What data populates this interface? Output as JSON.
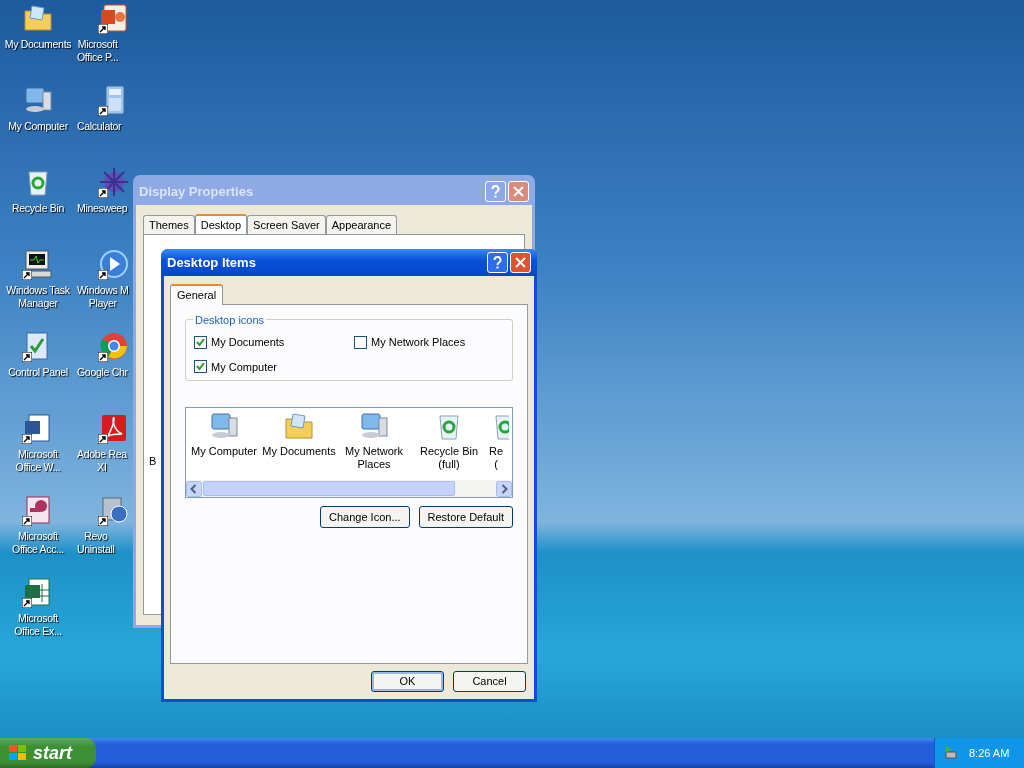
{
  "desktop_icons": [
    {
      "lines": [
        "My Documents"
      ],
      "shortcut": false
    },
    {
      "lines": [
        "Microsoft",
        "Office P..."
      ],
      "shortcut": true
    },
    {
      "lines": [
        "My Computer"
      ],
      "shortcut": false
    },
    {
      "lines": [
        "Calculator"
      ],
      "shortcut": true
    },
    {
      "lines": [
        "Recycle Bin"
      ],
      "shortcut": false
    },
    {
      "lines": [
        "Minesweep"
      ],
      "shortcut": true
    },
    {
      "lines": [
        "Windows Task",
        "Manager"
      ],
      "shortcut": true
    },
    {
      "lines": [
        "Windows M",
        "Player"
      ],
      "shortcut": true
    },
    {
      "lines": [
        "Control Panel"
      ],
      "shortcut": true
    },
    {
      "lines": [
        "Google Chr"
      ],
      "shortcut": true
    },
    {
      "lines": [
        "Microsoft",
        "Office W..."
      ],
      "shortcut": true
    },
    {
      "lines": [
        "Adobe Rea",
        "XI"
      ],
      "shortcut": true
    },
    {
      "lines": [
        "Microsoft",
        "Office Acc..."
      ],
      "shortcut": true
    },
    {
      "lines": [
        "Revo",
        "Uninstall"
      ],
      "shortcut": true
    },
    {
      "lines": [
        "Microsoft",
        "Office Ex..."
      ],
      "shortcut": true
    }
  ],
  "display_properties": {
    "title": "Display Properties",
    "tabs": [
      {
        "label": "Themes",
        "selected": false
      },
      {
        "label": "Desktop",
        "selected": true
      },
      {
        "label": "Screen Saver",
        "selected": false
      },
      {
        "label": "Appearance",
        "selected": false
      }
    ],
    "partial_label": "B"
  },
  "desktop_items": {
    "title": "Desktop Items",
    "tabs": [
      {
        "label": "General",
        "selected": true
      }
    ],
    "group_title": "Desktop icons",
    "checkboxes": [
      {
        "label": "My Documents",
        "checked": true
      },
      {
        "label": "My Network Places",
        "checked": false
      },
      {
        "label": "My Computer",
        "checked": true
      }
    ],
    "icons": [
      {
        "lines": [
          "My Computer"
        ]
      },
      {
        "lines": [
          "My Documents"
        ]
      },
      {
        "lines": [
          "My Network",
          "Places"
        ]
      },
      {
        "lines": [
          "Recycle Bin",
          "(full)"
        ]
      },
      {
        "lines": [
          "Re",
          "("
        ]
      }
    ],
    "buttons": [
      "Change Icon...",
      "Restore Default"
    ],
    "footer_buttons": [
      {
        "label": "OK",
        "default": true
      },
      {
        "label": "Cancel",
        "default": false
      }
    ]
  },
  "taskbar": {
    "start": "start",
    "clock": "8:26 AM"
  }
}
